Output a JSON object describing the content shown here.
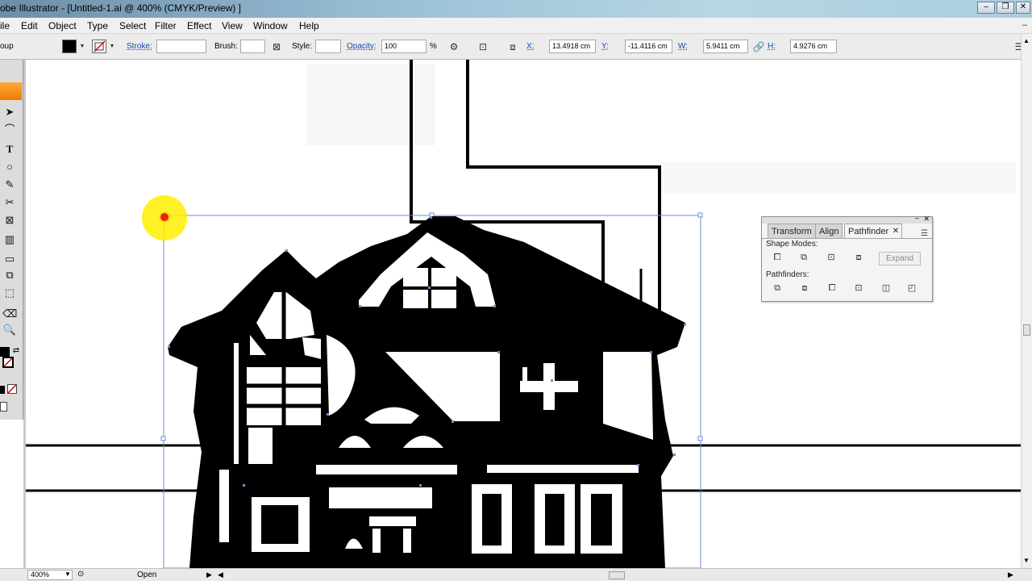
{
  "window": {
    "title": "obe Illustrator - [Untitled-1.ai @ 400% (CMYK/Preview) ]",
    "controls": [
      "‒",
      "❐",
      "✕"
    ]
  },
  "menu": [
    "ile",
    "Edit",
    "Object",
    "Type",
    "Select",
    "Filter",
    "Effect",
    "View",
    "Window",
    "Help"
  ],
  "menu_close": "‒",
  "control_bar": {
    "group_label": "oup",
    "stroke_label": "Stroke:",
    "brush_label": "Brush:",
    "style_label": "Style:",
    "opacity_label": "Opacity:",
    "opacity_value": "100",
    "percent": "%",
    "x_label": "X:",
    "x_value": "13.4918 cm",
    "y_label": "Y:",
    "y_value": "-11.4116 cm",
    "w_label": "W:",
    "w_value": "5.9411 cm",
    "h_label": "H:",
    "h_value": "4.9276 cm",
    "fill_color": "#000000"
  },
  "panel": {
    "tabs": [
      "Transform",
      "Align",
      "Pathfinder"
    ],
    "active_tab": "Pathfinder",
    "tab_close": "✕",
    "shape_modes_label": "Shape Modes:",
    "pathfinders_label": "Pathfinders:",
    "expand_label": "Expand"
  },
  "status": {
    "zoom": "400%",
    "open_label": "Open"
  },
  "colors": {
    "accent_orange": "#f08200",
    "selection_blue": "#4a6fd0",
    "link_blue": "#1b49a8"
  }
}
